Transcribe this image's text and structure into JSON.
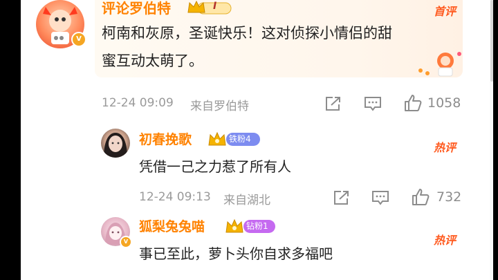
{
  "top_comment": {
    "user_name": "评论罗伯特",
    "level_badge": "I",
    "tag": "首评",
    "text_line1": "柯南和灰原，圣诞快乐！这对侦探小情侣的甜",
    "text_line2": "蜜互动太萌了。",
    "timestamp": "12-24 09:09",
    "source": "来自罗伯特",
    "like_count": "1058"
  },
  "replies": [
    {
      "user_name": "初春挽歌",
      "fan_badge": "铁粉4",
      "tag": "热评",
      "text": "凭借一己之力惹了所有人",
      "timestamp": "12-24 09:13",
      "source": "来自湖北",
      "like_count": "732"
    },
    {
      "user_name": "狐梨兔兔喵",
      "fan_badge": "钻粉1",
      "tag": "热评",
      "text": "事已至此，萝卜头你自求多福吧"
    }
  ],
  "colors": {
    "accent": "#ff8200",
    "hot_tag": "#ff5a1f",
    "meta_gray": "#9a9a9a",
    "iron_fan": "#7d8cf0",
    "diamond_fan": "#c56af0"
  }
}
